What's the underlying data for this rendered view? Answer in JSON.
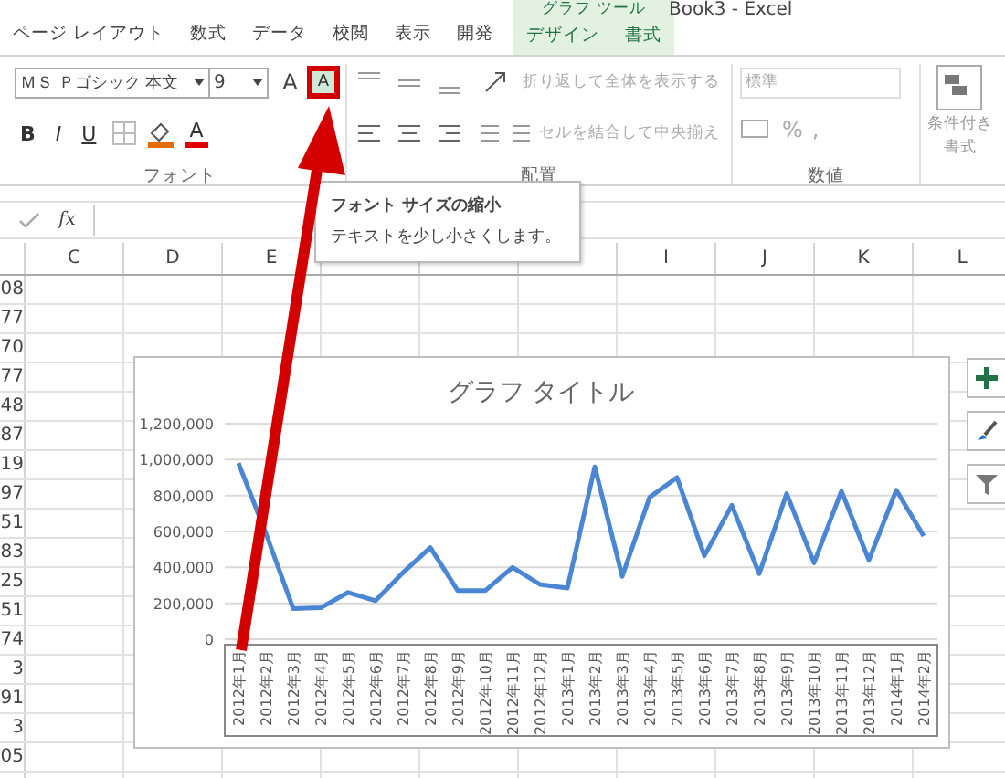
{
  "window": {
    "title": "Book3 - Excel"
  },
  "contextual_group": "グラフ ツール",
  "tabs": [
    {
      "label": "ページ レイアウト",
      "contextual": false
    },
    {
      "label": "数式",
      "contextual": false
    },
    {
      "label": "データ",
      "contextual": false
    },
    {
      "label": "校閲",
      "contextual": false
    },
    {
      "label": "表示",
      "contextual": false
    },
    {
      "label": "開発",
      "contextual": false
    },
    {
      "label": "デザイン",
      "contextual": true
    },
    {
      "label": "書式",
      "contextual": true
    }
  ],
  "ribbon": {
    "font_name": "ＭＳ Ｐゴシック 本文",
    "font_size": "9",
    "grow_font": {
      "label": "A",
      "highlighted": false
    },
    "shrink_font": {
      "label": "A",
      "highlighted": true
    },
    "bold": "B",
    "italic": "I",
    "underline": "U",
    "font_color": "A",
    "font_group": "フォント",
    "wrap_text": "折り返して全体を表示する",
    "merge_center": "セルを結合して中央揃え",
    "alignment_group": "配置",
    "number_format": "標準",
    "percent": "%",
    "comma": ",",
    "number_group": "数値",
    "conditional_formatting": "条件付き",
    "conditional_formatting_2": "書式"
  },
  "formula_bar": {
    "function_label": "fx"
  },
  "tooltip": {
    "title": "フォント サイズの縮小",
    "text": "テキストを少し小さくします。"
  },
  "columns_left": [
    "C",
    "D",
    "E"
  ],
  "columns_right": [
    "I",
    "J",
    "K",
    "L"
  ],
  "row_values": [
    "08",
    "77",
    "70",
    "77",
    "48",
    "87",
    "19",
    "97",
    "51",
    "83",
    "25",
    "51",
    "74",
    "3",
    "91",
    "3",
    "05"
  ],
  "chart": {
    "chart_data": {
      "type": "line",
      "title": "グラフ タイトル",
      "categories": [
        "2012年1月",
        "2012年2月",
        "2012年3月",
        "2012年4月",
        "2012年5月",
        "2012年6月",
        "2012年7月",
        "2012年8月",
        "2012年9月",
        "2012年10月",
        "2012年11月",
        "2012年12月",
        "2013年1月",
        "2013年2月",
        "2013年3月",
        "2013年4月",
        "2013年5月",
        "2013年6月",
        "2013年7月",
        "2013年8月",
        "2013年9月",
        "2013年10月",
        "2013年11月",
        "2013年12月",
        "2014年1月",
        "2014年2月"
      ],
      "grid": true,
      "series": [
        {
          "color": "#4a86d4",
          "values": [
            980000,
            590000,
            170000,
            175000,
            260000,
            215000,
            370000,
            510000,
            270000,
            270000,
            400000,
            305000,
            285000,
            960000,
            350000,
            790000,
            900000,
            465000,
            745000,
            365000,
            810000,
            425000,
            825000,
            440000,
            830000,
            575000
          ]
        }
      ],
      "ylim": [
        0,
        1200000
      ],
      "yticks": [
        {
          "value": 0,
          "label": "0"
        },
        {
          "value": 200000,
          "label": "200,000"
        },
        {
          "value": 400000,
          "label": "400,000"
        },
        {
          "value": 600000,
          "label": "600,000"
        },
        {
          "value": 800000,
          "label": "800,000"
        },
        {
          "value": 1000000,
          "label": "1,000,000"
        },
        {
          "value": 1200000,
          "label": "1,200,000"
        }
      ]
    }
  }
}
